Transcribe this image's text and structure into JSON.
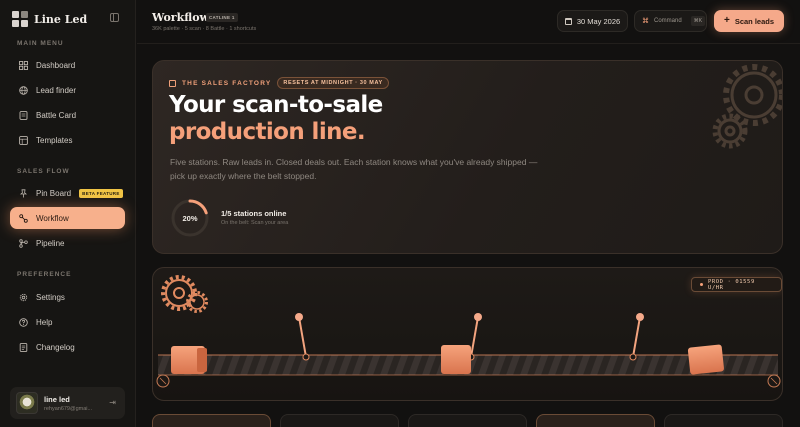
{
  "sidebar": {
    "brand": "Line Led",
    "sections": [
      {
        "label": "MAIN MENU"
      },
      {
        "label": "SALES FLOW"
      },
      {
        "label": "PREFERENCE"
      }
    ],
    "items": [
      {
        "label": "Dashboard",
        "icon": "dashboard-icon"
      },
      {
        "label": "Lead finder",
        "icon": "globe-icon"
      },
      {
        "label": "Battle Card",
        "icon": "card-icon"
      },
      {
        "label": "Templates",
        "icon": "templates-icon"
      },
      {
        "label": "Pin Board",
        "icon": "pin-icon",
        "badge": "BETA FEATURE"
      },
      {
        "label": "Workflow",
        "icon": "workflow-icon",
        "active": true
      },
      {
        "label": "Pipeline",
        "icon": "pipeline-icon"
      },
      {
        "label": "Settings",
        "icon": "gear-icon"
      },
      {
        "label": "Help",
        "icon": "help-icon"
      },
      {
        "label": "Changelog",
        "icon": "changelog-icon"
      }
    ],
    "user": {
      "name": "line led",
      "email": "rehyan679@gmai..."
    }
  },
  "header": {
    "title": "Workflow",
    "badge": "CATLINE 1",
    "subtitle": "36K palette · 5 scan · 8 Battle · 1 shortcuts",
    "date": "30 May 2026",
    "command_label": "Command",
    "command_kbd": "⌘K",
    "scan_label": "Scan leads"
  },
  "hero": {
    "eyebrow": "THE SALES FACTORY",
    "reset_pill": "RESETS AT MIDNIGHT · 30 MAY",
    "title_line1": "Your scan-to-sale",
    "title_line2": "production line.",
    "description": "Five stations. Raw leads in. Closed deals out. Each station knows what you've already shipped — pick up exactly where the belt stopped.",
    "progress_label": "20%",
    "progress_fraction": 0.2,
    "stations_title": "1/5 stations online",
    "stations_sub": "On the belt: Scan your area"
  },
  "conveyor": {
    "readout": "PROD · 01559 U/HR"
  },
  "colors": {
    "accent": "#f5a07a",
    "active_nav": "#f7b08c",
    "beta_badge": "#f0c445",
    "background": "#121110"
  }
}
